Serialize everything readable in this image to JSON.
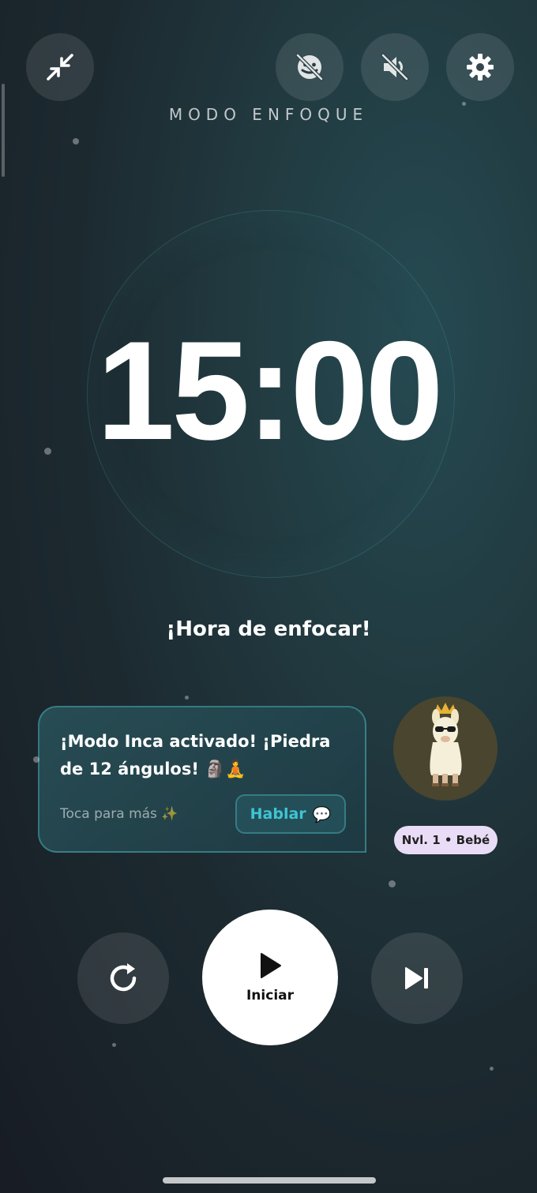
{
  "header": {
    "mode_title": "MODO ENFOQUE",
    "icons": {
      "minimize": "minimize-arrows-icon",
      "focus_off": "focus-off-icon",
      "sound_off": "volume-off-icon",
      "settings": "gear-icon"
    }
  },
  "timer": {
    "display": "15:00",
    "status": "¡Hora de enfocar!"
  },
  "mascot": {
    "message": "¡Modo Inca activado! ¡Piedra de 12 ángulos! 🗿🧘",
    "hint": "Toca para más ✨",
    "talk_label": "Hablar",
    "talk_icon": "💬",
    "level_badge": "Nvl. 1 • Bebé",
    "avatar_icon": "llama-with-crown-icon"
  },
  "controls": {
    "reset_icon": "restart-icon",
    "start_label": "Iniciar",
    "start_icon": "play-icon",
    "skip_icon": "skip-next-icon"
  },
  "colors": {
    "accent": "#3ec4d2",
    "badge_bg": "#e9dcf7",
    "start_bg": "#ffffff"
  }
}
